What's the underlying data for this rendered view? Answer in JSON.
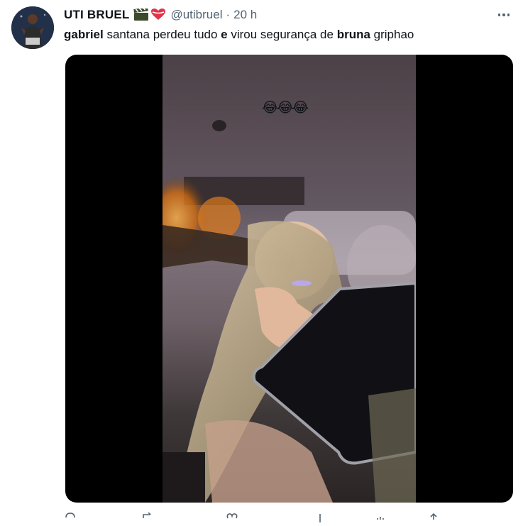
{
  "author": {
    "display_name": "UTI BRUEL",
    "name_emojis": [
      "clapper-board-emoji",
      "heart-emoji"
    ],
    "handle": "@utibruel",
    "separator": "·",
    "time": "20 h"
  },
  "tweet": {
    "text_parts": [
      {
        "text": "gabriel",
        "bold": true
      },
      {
        "text": " santana perdeu tudo ",
        "bold": false
      },
      {
        "text": "e",
        "bold": true
      },
      {
        "text": " virou segurança de ",
        "bold": false
      },
      {
        "text": "bruna",
        "bold": true
      },
      {
        "text": " griphao",
        "bold": false
      }
    ]
  },
  "media": {
    "type": "video",
    "overlay_text": "😂😂😂"
  },
  "actions": [
    {
      "name": "reply-icon"
    },
    {
      "name": "retweet-icon"
    },
    {
      "name": "like-icon"
    },
    {
      "name": "views-icon"
    },
    {
      "name": "bookmark-icon"
    },
    {
      "name": "share-icon"
    }
  ],
  "colors": {
    "text": "#0f1419",
    "secondary": "#536471",
    "heart": "#e3324a",
    "media_bg": "#000000"
  }
}
